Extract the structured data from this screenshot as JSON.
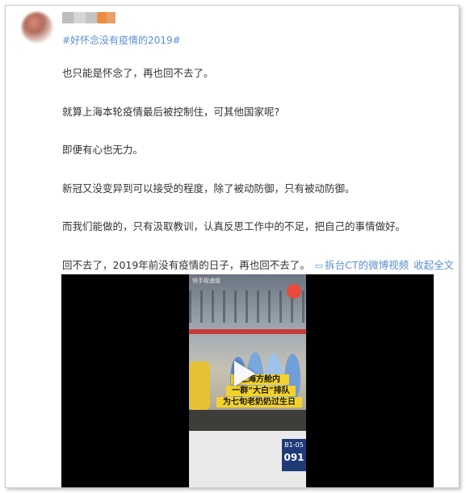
{
  "post": {
    "username": "••••••",
    "hashtag": "#好怀念没有疫情的2019#",
    "paragraphs": [
      "也只能是怀念了，再也回不去了。",
      "就算上海本轮疫情最后被控制住，可其他国家呢?",
      "即便有心也无力。",
      "新冠又没变异到可以接受的程度，除了被动防御，只有被动防御。",
      "而我们能做的，只有汲取教训，认真反思工作中的不足，把自己的事情做好。"
    ],
    "last_paragraph": "回不去了，2019年前没有疫情的日子，再也回不去了。",
    "video_link_icon": "play-box-icon",
    "video_link_text": "拆台CT的微博视频",
    "expand_text": "收起全文"
  },
  "video": {
    "watermark_line1": "快手极速版",
    "watermark_line2": "",
    "caption_lines": [
      "上海方舱内",
      "一群“大白”排队",
      "为七旬老奶奶过生日"
    ],
    "sign_code": "B1-05",
    "sign_number": "091",
    "play_icon": "play-icon"
  }
}
